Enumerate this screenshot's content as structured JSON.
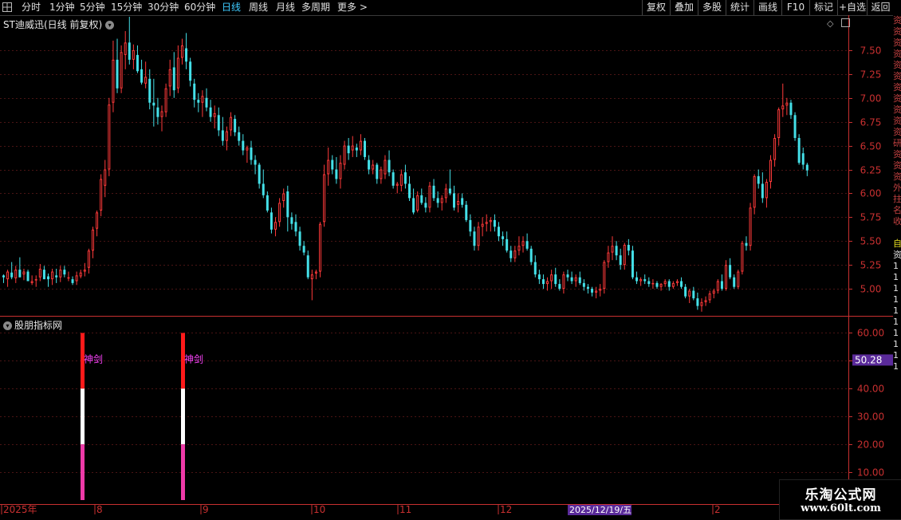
{
  "toolbar": {
    "periods": [
      {
        "label": "分时"
      },
      {
        "label": "1分钟"
      },
      {
        "label": "5分钟"
      },
      {
        "label": "15分钟"
      },
      {
        "label": "30分钟"
      },
      {
        "label": "60分钟"
      },
      {
        "label": "日线",
        "active": true
      },
      {
        "label": "周线"
      },
      {
        "label": "月线"
      },
      {
        "label": "多周期"
      },
      {
        "label": "更多 >"
      }
    ],
    "right_buttons": [
      "复权",
      "叠加",
      "多股",
      "统计",
      "画线",
      "F10",
      "标记",
      "+自选",
      "返回"
    ]
  },
  "stock": {
    "title": "ST迪威迅(日线 前复权)",
    "price_ticks": [
      "7.50",
      "7.25",
      "7.00",
      "6.75",
      "6.50",
      "6.25",
      "6.00",
      "5.75",
      "5.50",
      "5.25",
      "5.00"
    ]
  },
  "indicator": {
    "title": "股朋指标网",
    "ticks": [
      "60.00",
      "50.00",
      "40.00",
      "30.00",
      "20.00",
      "10.00"
    ],
    "current_value": "50.28",
    "signal_label": "神剑",
    "signals": [
      {
        "bar": "2025-07-31"
      },
      {
        "bar": "2025-08-29"
      }
    ]
  },
  "time_axis": {
    "labels": [
      "2025年",
      "8",
      "9",
      "10",
      "11",
      "12",
      "2"
    ],
    "cursor_date": "2025/12/19/五"
  },
  "side_strip": [
    "资",
    "资",
    "资",
    "资",
    "资",
    "资",
    "资",
    "资",
    "资",
    "资",
    "资",
    "研",
    "资",
    "资",
    "资",
    "外",
    "拄",
    "名",
    "收",
    "",
    "自",
    "资",
    "1",
    "1",
    "1",
    "1",
    "1",
    "1",
    "1",
    "1",
    "1",
    "1"
  ],
  "watermark": {
    "line1": "乐淘公式网",
    "line2": "www.60lt.com"
  },
  "colors": {
    "up": "#ff3a3a",
    "down": "#44e0e8",
    "active_tab": "#3ecbff",
    "signal_top": "#ff1a1a",
    "signal_mid": "#ffffff",
    "signal_bottom": "#ee3aa8",
    "signal_text": "#ff44ff",
    "axis": "#c83030",
    "cursor_bg": "#5a2a9a"
  },
  "chart_data": {
    "type": "candlestick",
    "price_range": [
      4.75,
      7.75
    ],
    "indicator_range": [
      0,
      65
    ],
    "candles": [
      [
        5.14,
        5.15,
        5.06,
        5.12
      ],
      [
        5.1,
        5.2,
        5.02,
        5.18
      ],
      [
        5.17,
        5.28,
        5.1,
        5.12
      ],
      [
        5.11,
        5.24,
        5.06,
        5.2
      ],
      [
        5.2,
        5.33,
        5.12,
        5.12
      ],
      [
        5.15,
        5.21,
        5.09,
        5.18
      ],
      [
        5.18,
        5.2,
        5.08,
        5.08
      ],
      [
        5.06,
        5.14,
        5.04,
        5.08
      ],
      [
        5.1,
        5.14,
        5.02,
        5.1
      ],
      [
        5.12,
        5.26,
        5.08,
        5.21
      ],
      [
        5.2,
        5.24,
        5.1,
        5.1
      ],
      [
        5.13,
        5.16,
        5.02,
        5.1
      ],
      [
        5.1,
        5.21,
        5.04,
        5.18
      ],
      [
        5.14,
        5.21,
        5.06,
        5.12
      ],
      [
        5.12,
        5.24,
        5.07,
        5.2
      ],
      [
        5.2,
        5.24,
        5.12,
        5.15
      ],
      [
        5.12,
        5.18,
        5.08,
        5.12
      ],
      [
        5.1,
        5.13,
        5.04,
        5.06
      ],
      [
        5.08,
        5.18,
        5.04,
        5.14
      ],
      [
        5.13,
        5.2,
        5.11,
        5.17
      ],
      [
        5.18,
        5.27,
        5.13,
        5.2
      ],
      [
        5.22,
        5.42,
        5.16,
        5.4
      ],
      [
        5.4,
        5.65,
        5.32,
        5.62
      ],
      [
        5.63,
        5.82,
        5.55,
        5.8
      ],
      [
        5.82,
        6.2,
        5.76,
        6.15
      ],
      [
        6.08,
        6.35,
        5.96,
        6.25
      ],
      [
        6.25,
        7.0,
        6.18,
        6.93
      ],
      [
        6.95,
        7.6,
        6.85,
        7.4
      ],
      [
        7.4,
        7.62,
        7.05,
        7.1
      ],
      [
        7.1,
        7.55,
        7.05,
        7.48
      ],
      [
        7.45,
        7.7,
        7.3,
        7.58
      ],
      [
        7.58,
        7.85,
        7.35,
        7.4
      ],
      [
        7.4,
        7.56,
        7.3,
        7.5
      ],
      [
        7.45,
        7.55,
        7.26,
        7.28
      ],
      [
        7.3,
        7.4,
        7.14,
        7.16
      ],
      [
        7.15,
        7.38,
        7.1,
        7.22
      ],
      [
        7.2,
        7.3,
        6.88,
        6.95
      ],
      [
        6.95,
        7.2,
        6.7,
        6.92
      ],
      [
        6.9,
        7.0,
        6.72,
        6.8
      ],
      [
        6.8,
        6.92,
        6.65,
        6.86
      ],
      [
        6.85,
        7.15,
        6.8,
        7.1
      ],
      [
        7.12,
        7.4,
        7.02,
        7.3
      ],
      [
        7.32,
        7.48,
        7.0,
        7.08
      ],
      [
        7.1,
        7.55,
        7.05,
        7.42
      ],
      [
        7.42,
        7.62,
        7.35,
        7.55
      ],
      [
        7.52,
        7.68,
        7.3,
        7.38
      ],
      [
        7.38,
        7.42,
        7.12,
        7.18
      ],
      [
        7.15,
        7.2,
        6.9,
        6.98
      ],
      [
        6.98,
        7.05,
        6.85,
        6.95
      ],
      [
        6.95,
        7.08,
        6.8,
        7.02
      ],
      [
        7.0,
        7.1,
        6.86,
        6.9
      ],
      [
        6.9,
        6.98,
        6.75,
        6.8
      ],
      [
        6.8,
        6.92,
        6.68,
        6.84
      ],
      [
        6.82,
        6.9,
        6.6,
        6.66
      ],
      [
        6.66,
        6.8,
        6.5,
        6.55
      ],
      [
        6.55,
        6.7,
        6.45,
        6.65
      ],
      [
        6.66,
        6.85,
        6.6,
        6.8
      ],
      [
        6.78,
        6.82,
        6.6,
        6.64
      ],
      [
        6.64,
        6.7,
        6.5,
        6.55
      ],
      [
        6.55,
        6.62,
        6.4,
        6.45
      ],
      [
        6.45,
        6.5,
        6.32,
        6.48
      ],
      [
        6.48,
        6.55,
        6.3,
        6.35
      ],
      [
        6.35,
        6.4,
        6.2,
        6.3
      ],
      [
        6.3,
        6.32,
        6.05,
        6.1
      ],
      [
        6.1,
        6.25,
        5.95,
        5.98
      ],
      [
        5.98,
        6.02,
        5.8,
        5.82
      ],
      [
        5.8,
        5.85,
        5.58,
        5.62
      ],
      [
        5.62,
        5.75,
        5.55,
        5.7
      ],
      [
        5.7,
        5.95,
        5.65,
        5.9
      ],
      [
        5.92,
        6.05,
        5.85,
        6.0
      ],
      [
        6.02,
        6.08,
        5.6,
        5.75
      ],
      [
        5.75,
        5.8,
        5.62,
        5.68
      ],
      [
        5.7,
        5.78,
        5.55,
        5.6
      ],
      [
        5.6,
        5.65,
        5.4,
        5.45
      ],
      [
        5.45,
        5.5,
        5.35,
        5.38
      ],
      [
        5.35,
        5.4,
        5.1,
        5.12
      ],
      [
        5.1,
        5.2,
        4.88,
        5.15
      ],
      [
        5.16,
        5.2,
        5.1,
        5.18
      ],
      [
        5.18,
        5.7,
        5.12,
        5.68
      ],
      [
        5.7,
        6.3,
        5.65,
        6.2
      ],
      [
        6.2,
        6.48,
        6.08,
        6.35
      ],
      [
        6.35,
        6.4,
        6.2,
        6.25
      ],
      [
        6.25,
        6.38,
        6.1,
        6.15
      ],
      [
        6.15,
        6.4,
        6.05,
        6.32
      ],
      [
        6.3,
        6.55,
        6.25,
        6.5
      ],
      [
        6.5,
        6.58,
        6.35,
        6.42
      ],
      [
        6.45,
        6.6,
        6.38,
        6.5
      ],
      [
        6.48,
        6.52,
        6.38,
        6.45
      ],
      [
        6.45,
        6.62,
        6.4,
        6.55
      ],
      [
        6.55,
        6.58,
        6.35,
        6.38
      ],
      [
        6.35,
        6.4,
        6.2,
        6.25
      ],
      [
        6.25,
        6.35,
        6.2,
        6.3
      ],
      [
        6.3,
        6.32,
        6.1,
        6.15
      ],
      [
        6.15,
        6.28,
        6.1,
        6.25
      ],
      [
        6.2,
        6.4,
        6.15,
        6.35
      ],
      [
        6.35,
        6.45,
        6.18,
        6.22
      ],
      [
        6.22,
        6.25,
        6.05,
        6.08
      ],
      [
        6.08,
        6.12,
        6.0,
        6.1
      ],
      [
        6.08,
        6.25,
        6.02,
        6.2
      ],
      [
        6.22,
        6.3,
        6.05,
        6.1
      ],
      [
        6.1,
        6.18,
        5.92,
        5.95
      ],
      [
        5.95,
        6.05,
        5.78,
        5.8
      ],
      [
        5.82,
        6.02,
        5.8,
        5.98
      ],
      [
        5.98,
        6.05,
        5.88,
        5.9
      ],
      [
        5.9,
        5.96,
        5.8,
        5.85
      ],
      [
        5.85,
        6.12,
        5.8,
        6.08
      ],
      [
        6.08,
        6.15,
        5.92,
        5.95
      ],
      [
        5.95,
        6.02,
        5.85,
        5.9
      ],
      [
        5.9,
        5.98,
        5.82,
        5.95
      ],
      [
        5.95,
        6.1,
        5.9,
        6.05
      ],
      [
        6.05,
        6.25,
        5.98,
        6.0
      ],
      [
        6.0,
        6.08,
        5.82,
        5.85
      ],
      [
        5.88,
        6.0,
        5.8,
        5.92
      ],
      [
        5.95,
        6.0,
        5.85,
        5.88
      ],
      [
        5.88,
        5.92,
        5.7,
        5.72
      ],
      [
        5.72,
        5.78,
        5.55,
        5.6
      ],
      [
        5.6,
        5.65,
        5.4,
        5.45
      ],
      [
        5.45,
        5.7,
        5.4,
        5.65
      ],
      [
        5.65,
        5.75,
        5.55,
        5.68
      ],
      [
        5.68,
        5.78,
        5.6,
        5.7
      ],
      [
        5.7,
        5.75,
        5.6,
        5.72
      ],
      [
        5.72,
        5.78,
        5.6,
        5.65
      ],
      [
        5.65,
        5.7,
        5.5,
        5.55
      ],
      [
        5.55,
        5.6,
        5.45,
        5.52
      ],
      [
        5.52,
        5.6,
        5.38,
        5.4
      ],
      [
        5.4,
        5.45,
        5.28,
        5.32
      ],
      [
        5.32,
        5.45,
        5.28,
        5.4
      ],
      [
        5.4,
        5.55,
        5.35,
        5.45
      ],
      [
        5.45,
        5.55,
        5.38,
        5.5
      ],
      [
        5.5,
        5.58,
        5.4,
        5.42
      ],
      [
        5.42,
        5.45,
        5.25,
        5.28
      ],
      [
        5.28,
        5.35,
        5.12,
        5.15
      ],
      [
        5.15,
        5.2,
        5.05,
        5.1
      ],
      [
        5.1,
        5.15,
        5.0,
        5.05
      ],
      [
        5.05,
        5.12,
        4.98,
        5.08
      ],
      [
        5.08,
        5.2,
        5.0,
        5.15
      ],
      [
        5.15,
        5.22,
        5.02,
        5.05
      ],
      [
        5.05,
        5.1,
        4.98,
        5.0
      ],
      [
        5.0,
        5.18,
        4.95,
        5.15
      ],
      [
        5.15,
        5.2,
        5.08,
        5.12
      ],
      [
        5.12,
        5.18,
        5.05,
        5.08
      ],
      [
        5.08,
        5.15,
        5.02,
        5.12
      ],
      [
        5.12,
        5.18,
        5.04,
        5.06
      ],
      [
        5.06,
        5.1,
        4.98,
        5.02
      ],
      [
        5.02,
        5.05,
        4.95,
        5.0
      ],
      [
        5.0,
        5.02,
        4.92,
        4.96
      ],
      [
        4.96,
        5.02,
        4.9,
        4.98
      ],
      [
        4.98,
        5.05,
        4.92,
        5.0
      ],
      [
        5.0,
        5.3,
        4.95,
        5.28
      ],
      [
        5.28,
        5.45,
        5.22,
        5.38
      ],
      [
        5.38,
        5.55,
        5.3,
        5.45
      ],
      [
        5.45,
        5.5,
        5.3,
        5.35
      ],
      [
        5.35,
        5.42,
        5.2,
        5.25
      ],
      [
        5.25,
        5.48,
        5.2,
        5.46
      ],
      [
        5.46,
        5.52,
        5.35,
        5.4
      ],
      [
        5.4,
        5.45,
        5.1,
        5.12
      ],
      [
        5.12,
        5.18,
        5.05,
        5.08
      ],
      [
        5.08,
        5.12,
        5.03,
        5.1
      ],
      [
        5.1,
        5.15,
        5.05,
        5.08
      ],
      [
        5.08,
        5.12,
        5.02,
        5.05
      ],
      [
        5.05,
        5.1,
        5.0,
        5.06
      ],
      [
        5.06,
        5.08,
        5.0,
        5.02
      ],
      [
        5.02,
        5.06,
        4.98,
        5.05
      ],
      [
        5.05,
        5.1,
        5.02,
        5.08
      ],
      [
        5.08,
        5.1,
        4.98,
        5.02
      ],
      [
        5.02,
        5.08,
        5.0,
        5.06
      ],
      [
        5.06,
        5.1,
        5.03,
        5.08
      ],
      [
        5.08,
        5.12,
        5.0,
        5.02
      ],
      [
        5.02,
        5.05,
        4.9,
        4.92
      ],
      [
        4.92,
        5.0,
        4.85,
        4.98
      ],
      [
        4.98,
        5.02,
        4.88,
        4.9
      ],
      [
        4.9,
        4.96,
        4.78,
        4.82
      ],
      [
        4.82,
        4.9,
        4.76,
        4.86
      ],
      [
        4.86,
        4.92,
        4.82,
        4.88
      ],
      [
        4.88,
        4.98,
        4.85,
        4.95
      ],
      [
        4.95,
        5.0,
        4.9,
        4.98
      ],
      [
        4.98,
        5.1,
        4.95,
        5.08
      ],
      [
        5.08,
        5.15,
        4.98,
        5.0
      ],
      [
        5.0,
        5.3,
        4.98,
        5.25
      ],
      [
        5.25,
        5.32,
        5.1,
        5.12
      ],
      [
        5.12,
        5.15,
        5.0,
        5.02
      ],
      [
        5.02,
        5.2,
        5.0,
        5.18
      ],
      [
        5.18,
        5.5,
        5.15,
        5.48
      ],
      [
        5.48,
        5.55,
        5.4,
        5.45
      ],
      [
        5.45,
        5.9,
        5.4,
        5.85
      ],
      [
        5.85,
        6.2,
        5.78,
        6.18
      ],
      [
        6.18,
        6.25,
        6.05,
        6.1
      ],
      [
        6.1,
        6.22,
        5.9,
        5.95
      ],
      [
        5.95,
        6.15,
        5.85,
        6.12
      ],
      [
        6.12,
        6.4,
        6.05,
        6.35
      ],
      [
        6.35,
        6.62,
        6.28,
        6.58
      ],
      [
        6.58,
        6.9,
        6.5,
        6.88
      ],
      [
        6.88,
        7.15,
        6.8,
        6.92
      ],
      [
        6.92,
        7.0,
        6.82,
        6.95
      ],
      [
        6.95,
        6.98,
        6.78,
        6.82
      ],
      [
        6.82,
        6.85,
        6.55,
        6.58
      ],
      [
        6.58,
        6.62,
        6.3,
        6.32
      ],
      [
        6.42,
        6.48,
        6.25,
        6.3
      ],
      [
        6.3,
        6.32,
        6.18,
        6.24
      ]
    ],
    "signal_bars": [
      "2025-07-31",
      "2025-08-29"
    ],
    "signal_segments": [
      {
        "from": 40,
        "to": 60
      },
      {
        "from": 20,
        "to": 40
      },
      {
        "from": 0,
        "to": 20
      }
    ]
  }
}
